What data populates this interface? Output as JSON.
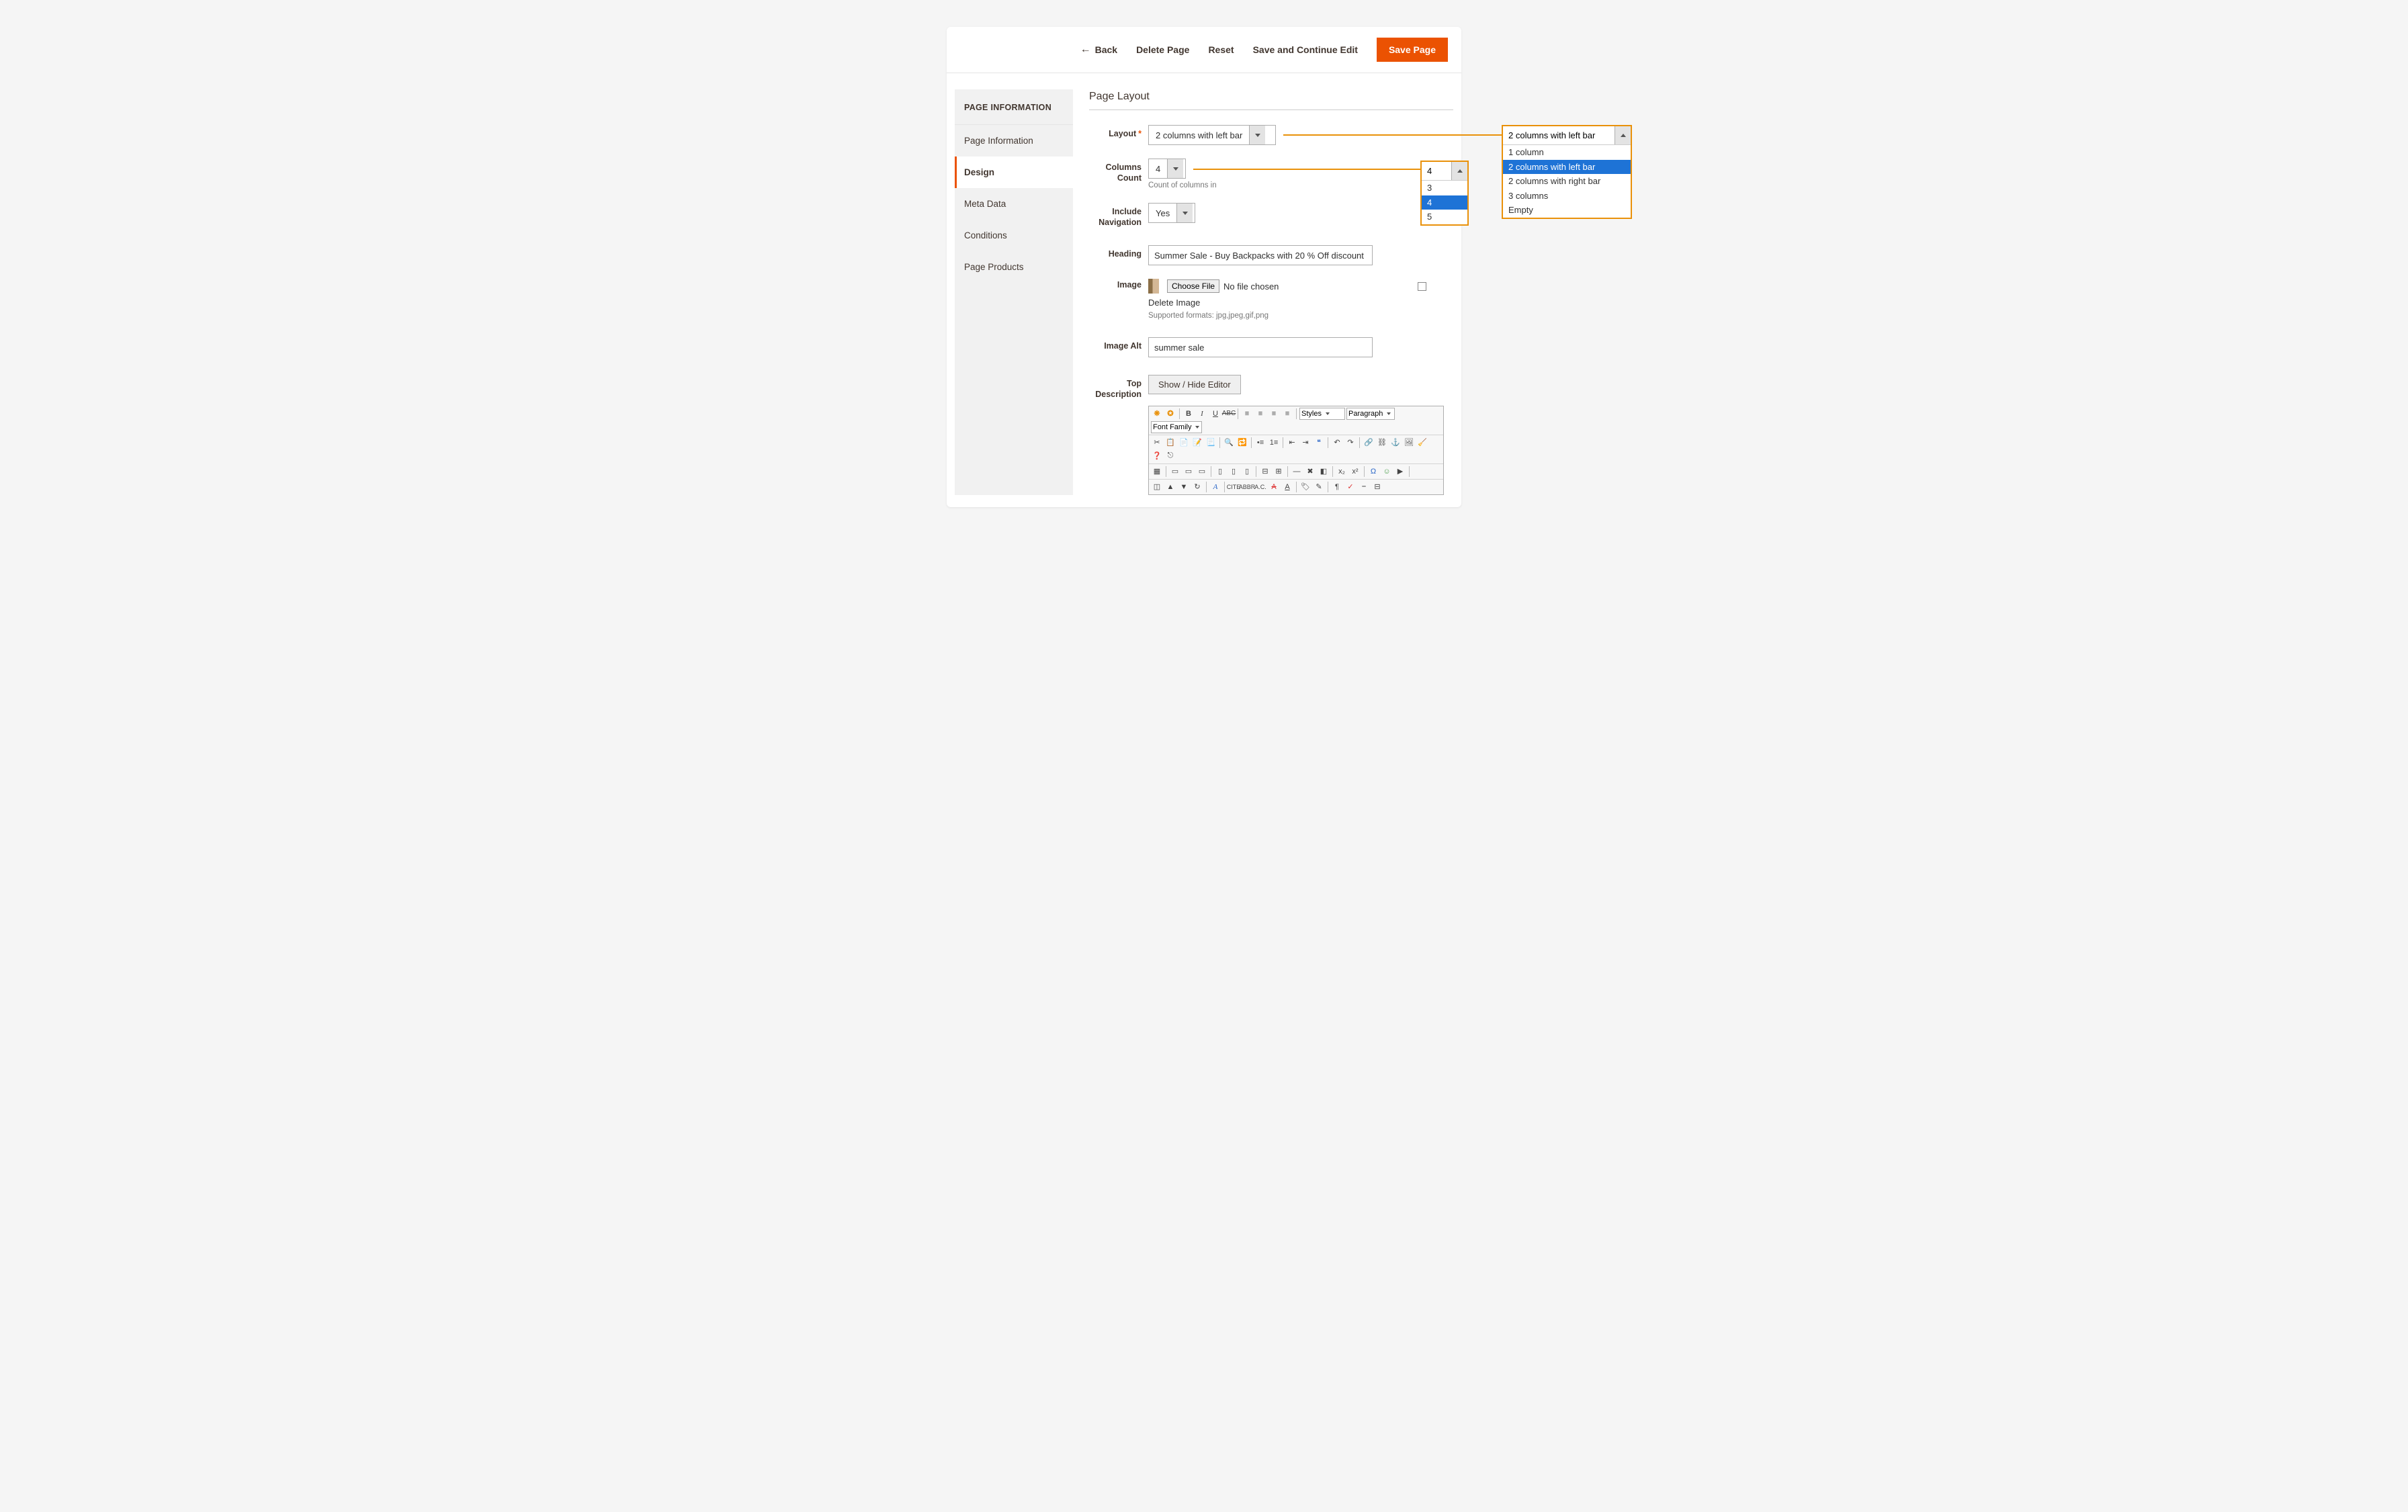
{
  "toolbar": {
    "back": "Back",
    "delete": "Delete Page",
    "reset": "Reset",
    "save_continue": "Save and Continue Edit",
    "save": "Save Page"
  },
  "sidebar": {
    "heading": "PAGE INFORMATION",
    "items": [
      {
        "label": "Page Information"
      },
      {
        "label": "Design"
      },
      {
        "label": "Meta Data"
      },
      {
        "label": "Conditions"
      },
      {
        "label": "Page Products"
      }
    ]
  },
  "section_title": "Page Layout",
  "form": {
    "layout": {
      "label": "Layout",
      "required": "*",
      "value": "2 columns with left bar",
      "callout_value": "2 columns with left bar",
      "options": [
        "1 column",
        "2 columns with left bar",
        "2 columns with right bar",
        "3 columns",
        "Empty"
      ]
    },
    "columns": {
      "label": "Columns Count",
      "value": "4",
      "callout_value": "4",
      "helper": "Count of columns in",
      "options": [
        "3",
        "4",
        "5"
      ]
    },
    "include_nav": {
      "label": "Include Navigation",
      "value": "Yes"
    },
    "heading": {
      "label": "Heading",
      "value": "Summer Sale - Buy Backpacks with 20 % Off discount"
    },
    "image": {
      "label": "Image",
      "choose_btn": "Choose File",
      "status": "No file chosen",
      "delete_link": "Delete Image",
      "formats": "Supported formats: jpg,jpeg,gif,png"
    },
    "image_alt": {
      "label": "Image Alt",
      "value": "summer sale"
    },
    "top_desc": {
      "label": "Top Description",
      "toggle_btn": "Show / Hide Editor"
    }
  },
  "tinymce": {
    "styles": "Styles",
    "paragraph": "Paragraph",
    "font_family": "Font Family"
  }
}
